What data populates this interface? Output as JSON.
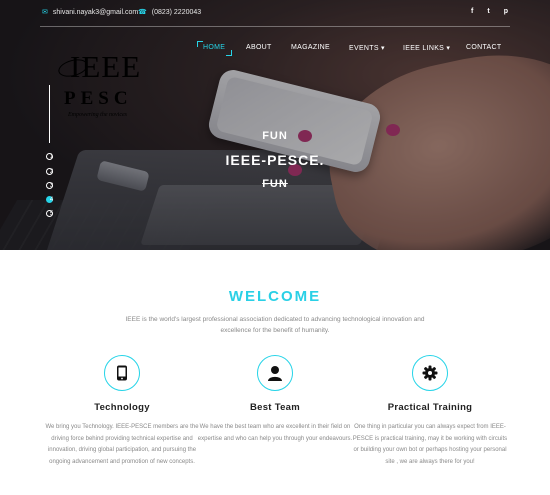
{
  "topbar": {
    "email": "shivani.nayak3@gmail.com",
    "phone": "(0823) 2220043",
    "social": [
      "f",
      "t",
      "p"
    ]
  },
  "logo": {
    "line1": "IEEE",
    "line2": "PESC",
    "tagline": "Empowering the novices"
  },
  "nav": {
    "items": [
      "HOME",
      "ABOUT",
      "MAGAZINE",
      "EVENTS ▾",
      "IEEE LINKS ▾",
      "CONTACT"
    ],
    "active": "HOME"
  },
  "hero": {
    "line1": "FUN",
    "line2": "IEEE-PESCE.",
    "line3": "FUN",
    "slides": [
      "1",
      "2",
      "3",
      "4",
      "5"
    ],
    "active_slide": "4"
  },
  "welcome": {
    "title": "WELCOME",
    "description": "IEEE is the world's largest professional association dedicated to advancing technological innovation and excellence for the benefit of humanity."
  },
  "features": [
    {
      "icon": "phone-icon",
      "title": "Technology",
      "description": "We bring you Technology. IEEE-PESCE members are the driving force behind providing technical expertise and innovation, driving global participation, and pursuing the ongoing advancement and promotion of new concepts."
    },
    {
      "icon": "user-icon",
      "title": "Best Team",
      "description": "We have the best team who are excellent in their field on expertise and who can help you through your endeavours."
    },
    {
      "icon": "gear-icon",
      "title": "Practical Training",
      "description": "One thing in particular you can always expect from IEEE-PESCE is practical training, may it be working with circuits or building your own bot or perhaps hosting your personal site , we are always there for you!"
    }
  ],
  "colors": {
    "accent": "#26d4e8",
    "text_muted": "#8a8a8a",
    "heading": "#222222"
  }
}
